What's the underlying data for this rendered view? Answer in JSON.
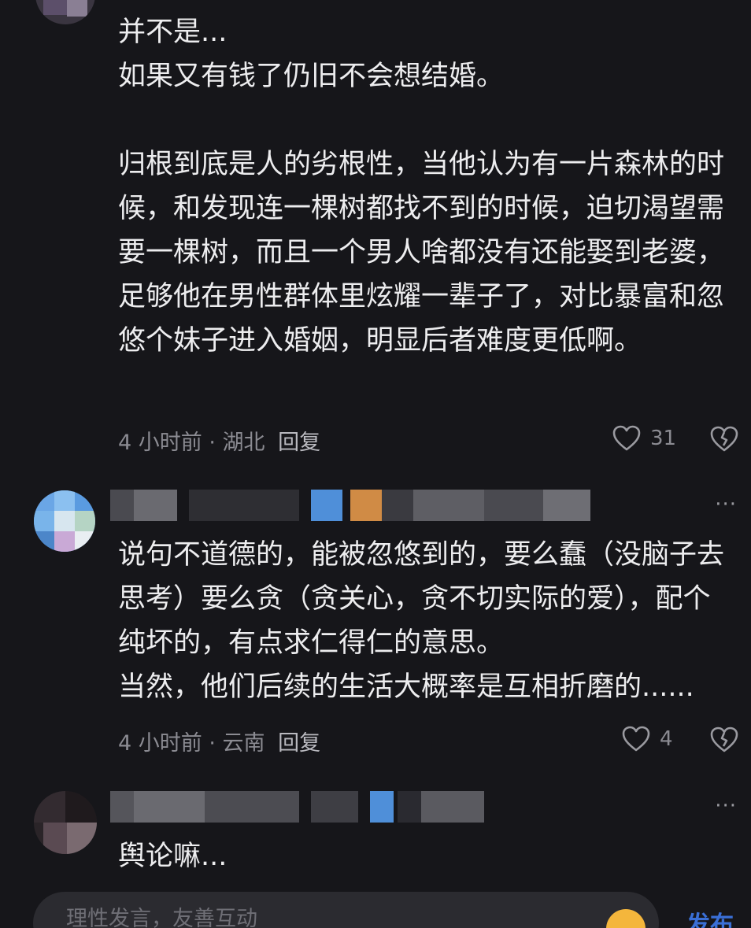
{
  "comments": [
    {
      "text": "并不是...\n如果又有钱了仍旧不会想结婚。\n\n归根到底是人的劣根性，当他认为有一片森林的时候，和发现连一棵树都找不到的时候，迫切渴望需要一棵树，而且一个男人啥都没有还能娶到老婆，足够他在男性群体里炫耀一辈子了，对比暴富和忽悠个妹子进入婚姻，明显后者难度更低啊。",
      "time": "4 小时前",
      "location": "湖北",
      "reply_label": "回复",
      "likes": "31"
    },
    {
      "text": "说句不道德的，能被忽悠到的，要么蠢（没脑子去思考）要么贪（贪关心，贪不切实际的爱），配个纯坏的，有点求仁得仁的意思。\n当然，他们后续的生活大概率是互相折磨的......",
      "time": "4 小时前",
      "location": "云南",
      "reply_label": "回复",
      "likes": "4"
    },
    {
      "text": "舆论嘛..."
    }
  ],
  "separator": " · ",
  "more_label": "···",
  "input": {
    "placeholder": "理性发言，友善互动",
    "send_label": "发布"
  },
  "colors": {
    "background": "#16161a",
    "text": "#ededef",
    "meta": "#8b8b92",
    "send": "#3a6fd6"
  }
}
